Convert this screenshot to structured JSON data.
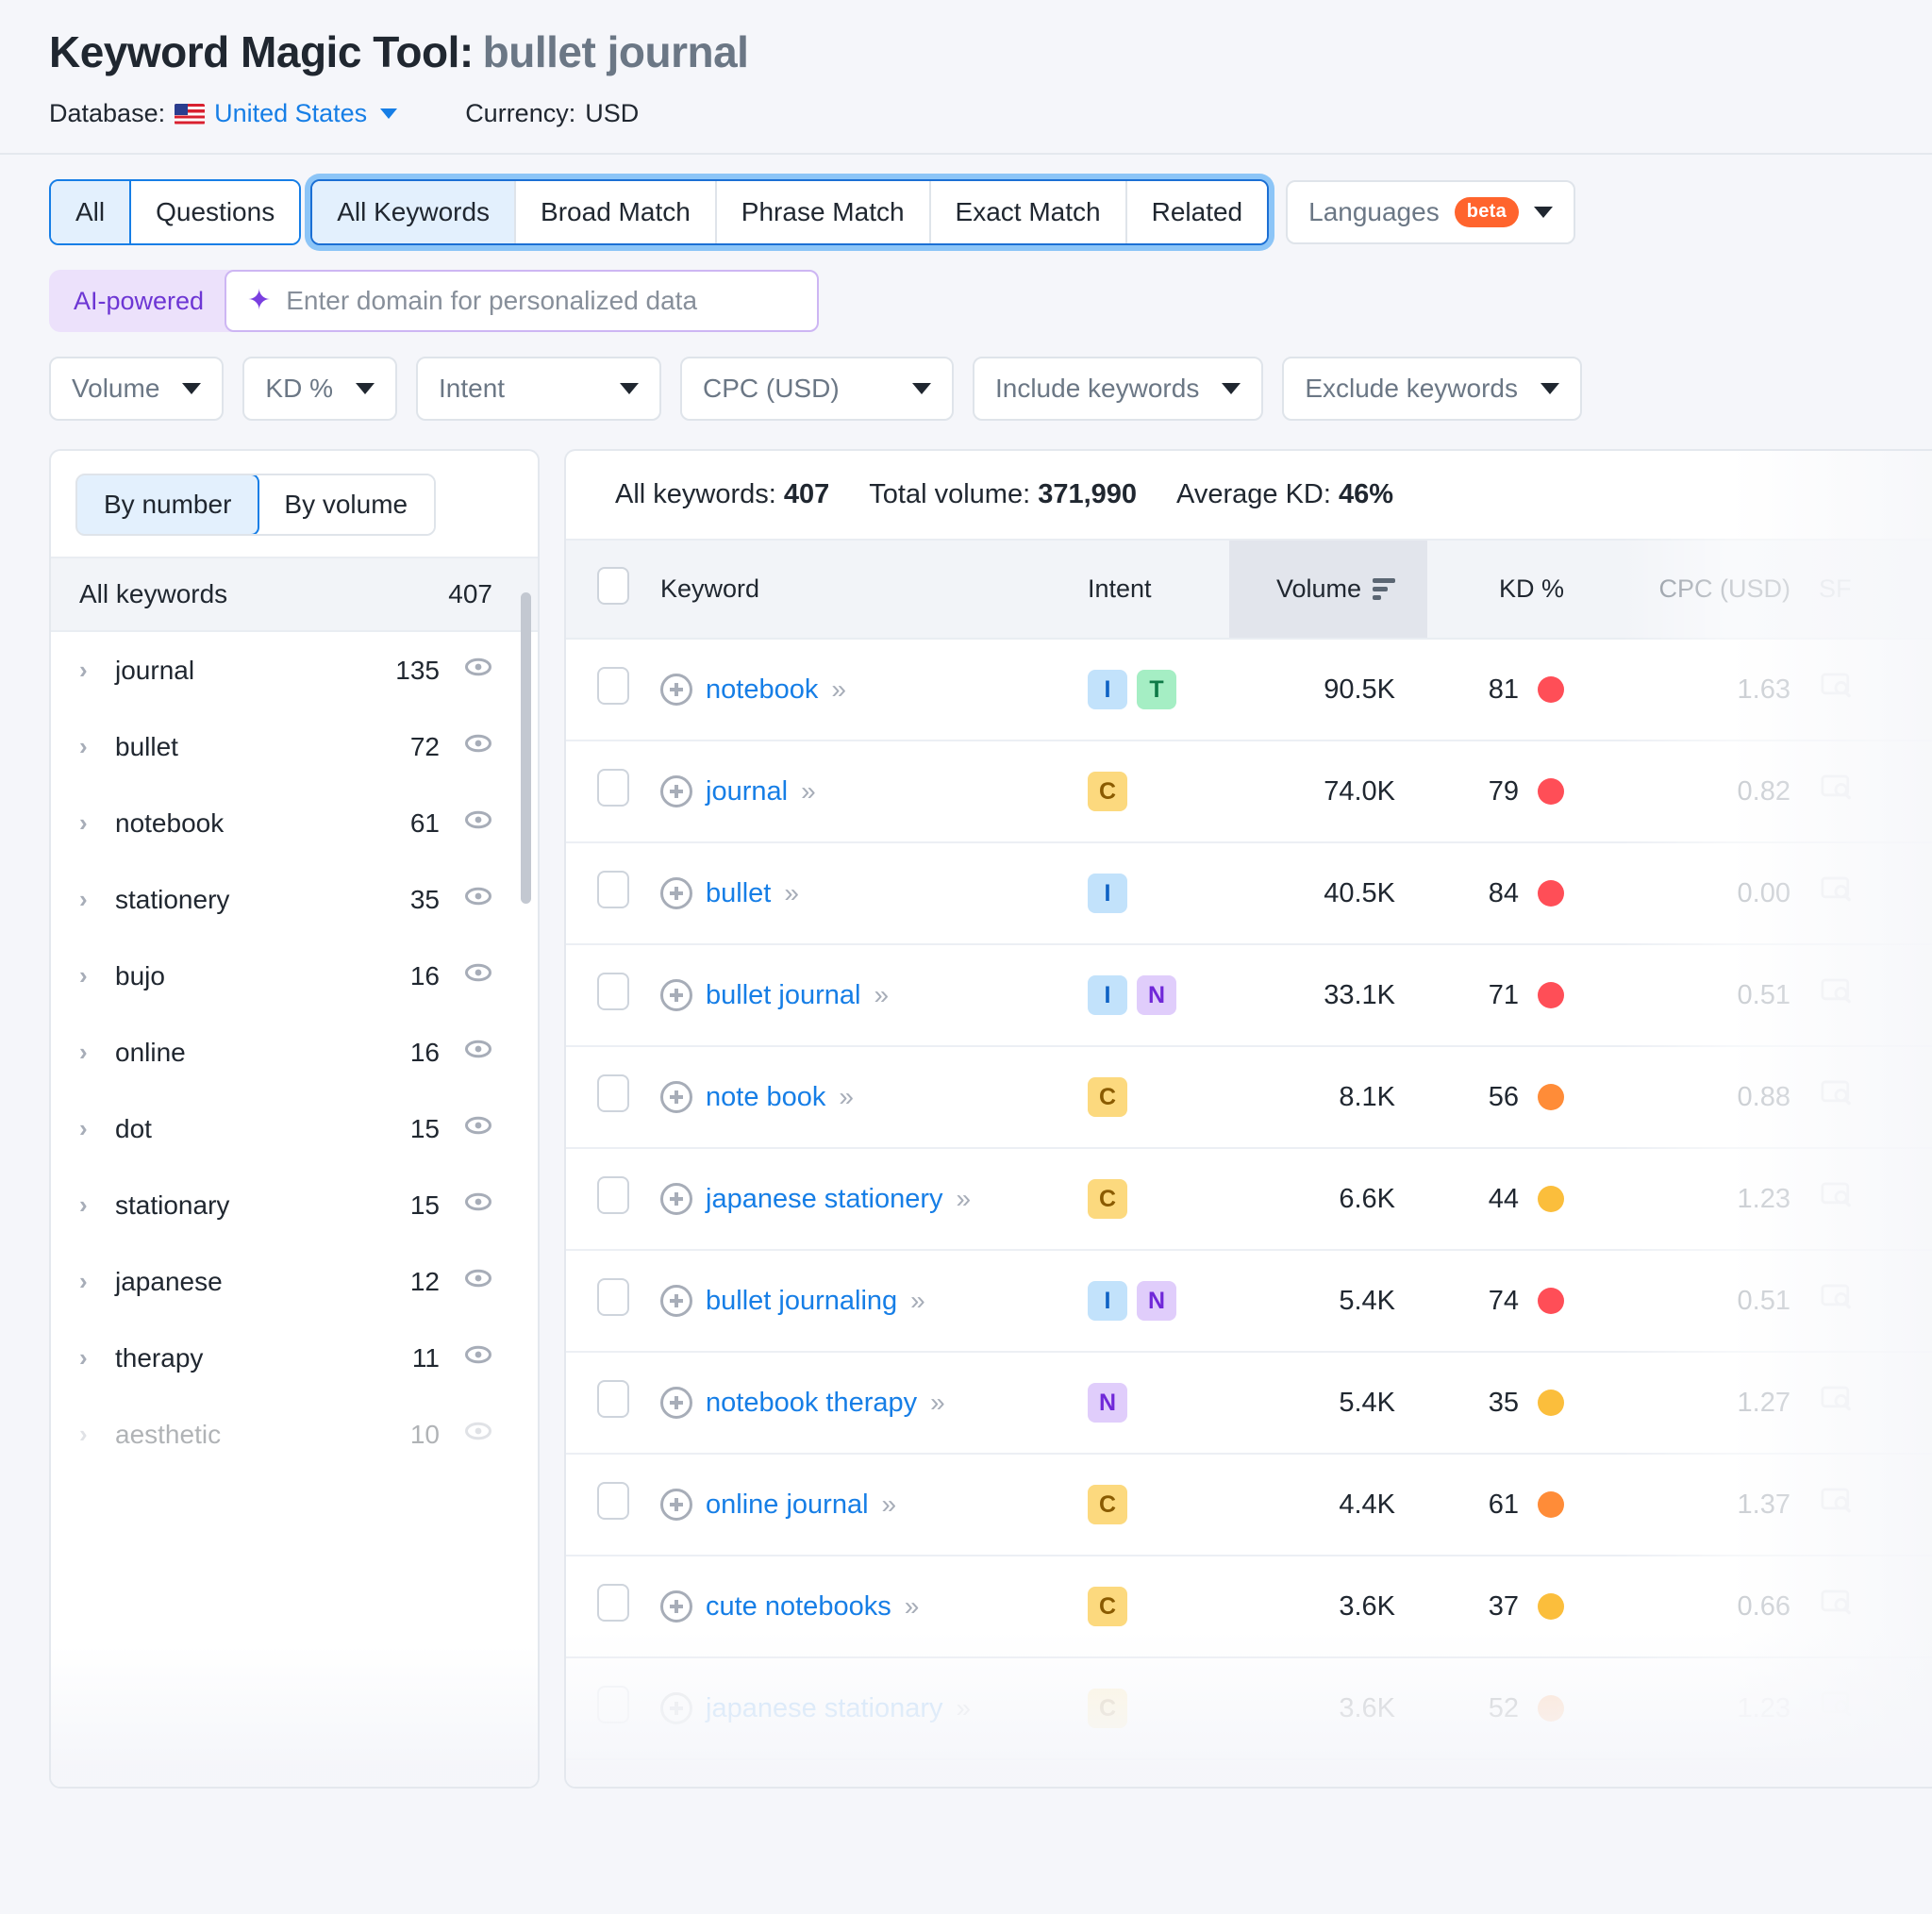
{
  "header": {
    "title_label": "Keyword Magic Tool:",
    "query": "bullet journal",
    "database_label": "Database:",
    "database_value": "United States",
    "currency_label": "Currency:",
    "currency_value": "USD"
  },
  "tabs": {
    "group_one": [
      {
        "label": "All",
        "active": true
      },
      {
        "label": "Questions",
        "active": false
      }
    ],
    "group_two": [
      {
        "label": "All Keywords",
        "active": true
      },
      {
        "label": "Broad Match",
        "active": false
      },
      {
        "label": "Phrase Match",
        "active": false
      },
      {
        "label": "Exact Match",
        "active": false
      },
      {
        "label": "Related",
        "active": false
      }
    ],
    "languages_label": "Languages",
    "languages_badge": "beta"
  },
  "ai_bar": {
    "label": "AI-powered",
    "placeholder": "Enter domain for personalized data",
    "icon": "sparkle-icon"
  },
  "filters": [
    {
      "label": "Volume"
    },
    {
      "label": "KD %"
    },
    {
      "label": "Intent"
    },
    {
      "label": "CPC (USD)"
    },
    {
      "label": "Include keywords"
    },
    {
      "label": "Exclude keywords"
    }
  ],
  "sidebar": {
    "segments": [
      {
        "label": "By number",
        "active": true
      },
      {
        "label": "By volume",
        "active": false
      }
    ],
    "all_keywords_label": "All keywords",
    "all_keywords_count": "407",
    "groups": [
      {
        "label": "journal",
        "count": "135",
        "faded": false
      },
      {
        "label": "bullet",
        "count": "72",
        "faded": false
      },
      {
        "label": "notebook",
        "count": "61",
        "faded": false
      },
      {
        "label": "stationery",
        "count": "35",
        "faded": false
      },
      {
        "label": "bujo",
        "count": "16",
        "faded": false
      },
      {
        "label": "online",
        "count": "16",
        "faded": false
      },
      {
        "label": "dot",
        "count": "15",
        "faded": false
      },
      {
        "label": "stationary",
        "count": "15",
        "faded": false
      },
      {
        "label": "japanese",
        "count": "12",
        "faded": false
      },
      {
        "label": "therapy",
        "count": "11",
        "faded": false
      },
      {
        "label": "aesthetic",
        "count": "10",
        "faded": true
      }
    ]
  },
  "summary": {
    "all_keywords_label": "All keywords:",
    "all_keywords_value": "407",
    "total_volume_label": "Total volume:",
    "total_volume_value": "371,990",
    "average_kd_label": "Average KD:",
    "average_kd_value": "46%"
  },
  "table": {
    "columns": {
      "keyword": "Keyword",
      "intent": "Intent",
      "volume": "Volume",
      "kd": "KD %",
      "cpc": "CPC (USD)",
      "serp": "SF"
    },
    "sorted_by": "Volume",
    "rows": [
      {
        "keyword": "notebook",
        "intents": [
          "I",
          "T"
        ],
        "volume": "90.5K",
        "kd": "81",
        "kd_color": "#ff4e57",
        "cpc": "1.63"
      },
      {
        "keyword": "journal",
        "intents": [
          "C"
        ],
        "volume": "74.0K",
        "kd": "79",
        "kd_color": "#ff4e57",
        "cpc": "0.82"
      },
      {
        "keyword": "bullet",
        "intents": [
          "I"
        ],
        "volume": "40.5K",
        "kd": "84",
        "kd_color": "#ff4e57",
        "cpc": "0.00"
      },
      {
        "keyword": "bullet journal",
        "intents": [
          "I",
          "N"
        ],
        "volume": "33.1K",
        "kd": "71",
        "kd_color": "#ff4e57",
        "cpc": "0.51"
      },
      {
        "keyword": "note book",
        "intents": [
          "C"
        ],
        "volume": "8.1K",
        "kd": "56",
        "kd_color": "#ff8c38",
        "cpc": "0.88"
      },
      {
        "keyword": "japanese stationery",
        "intents": [
          "C"
        ],
        "volume": "6.6K",
        "kd": "44",
        "kd_color": "#fbbe3c",
        "cpc": "1.23"
      },
      {
        "keyword": "bullet journaling",
        "intents": [
          "I",
          "N"
        ],
        "volume": "5.4K",
        "kd": "74",
        "kd_color": "#ff4e57",
        "cpc": "0.51"
      },
      {
        "keyword": "notebook therapy",
        "intents": [
          "N"
        ],
        "volume": "5.4K",
        "kd": "35",
        "kd_color": "#fbbe3c",
        "cpc": "1.27"
      },
      {
        "keyword": "online journal",
        "intents": [
          "C"
        ],
        "volume": "4.4K",
        "kd": "61",
        "kd_color": "#ff8c38",
        "cpc": "1.37"
      },
      {
        "keyword": "cute notebooks",
        "intents": [
          "C"
        ],
        "volume": "3.6K",
        "kd": "37",
        "kd_color": "#fbbe3c",
        "cpc": "0.66"
      },
      {
        "keyword": "japanese stationary",
        "intents": [
          "C"
        ],
        "volume": "3.6K",
        "kd": "52",
        "kd_color": "#ff8c38",
        "cpc": "1.23"
      }
    ]
  }
}
